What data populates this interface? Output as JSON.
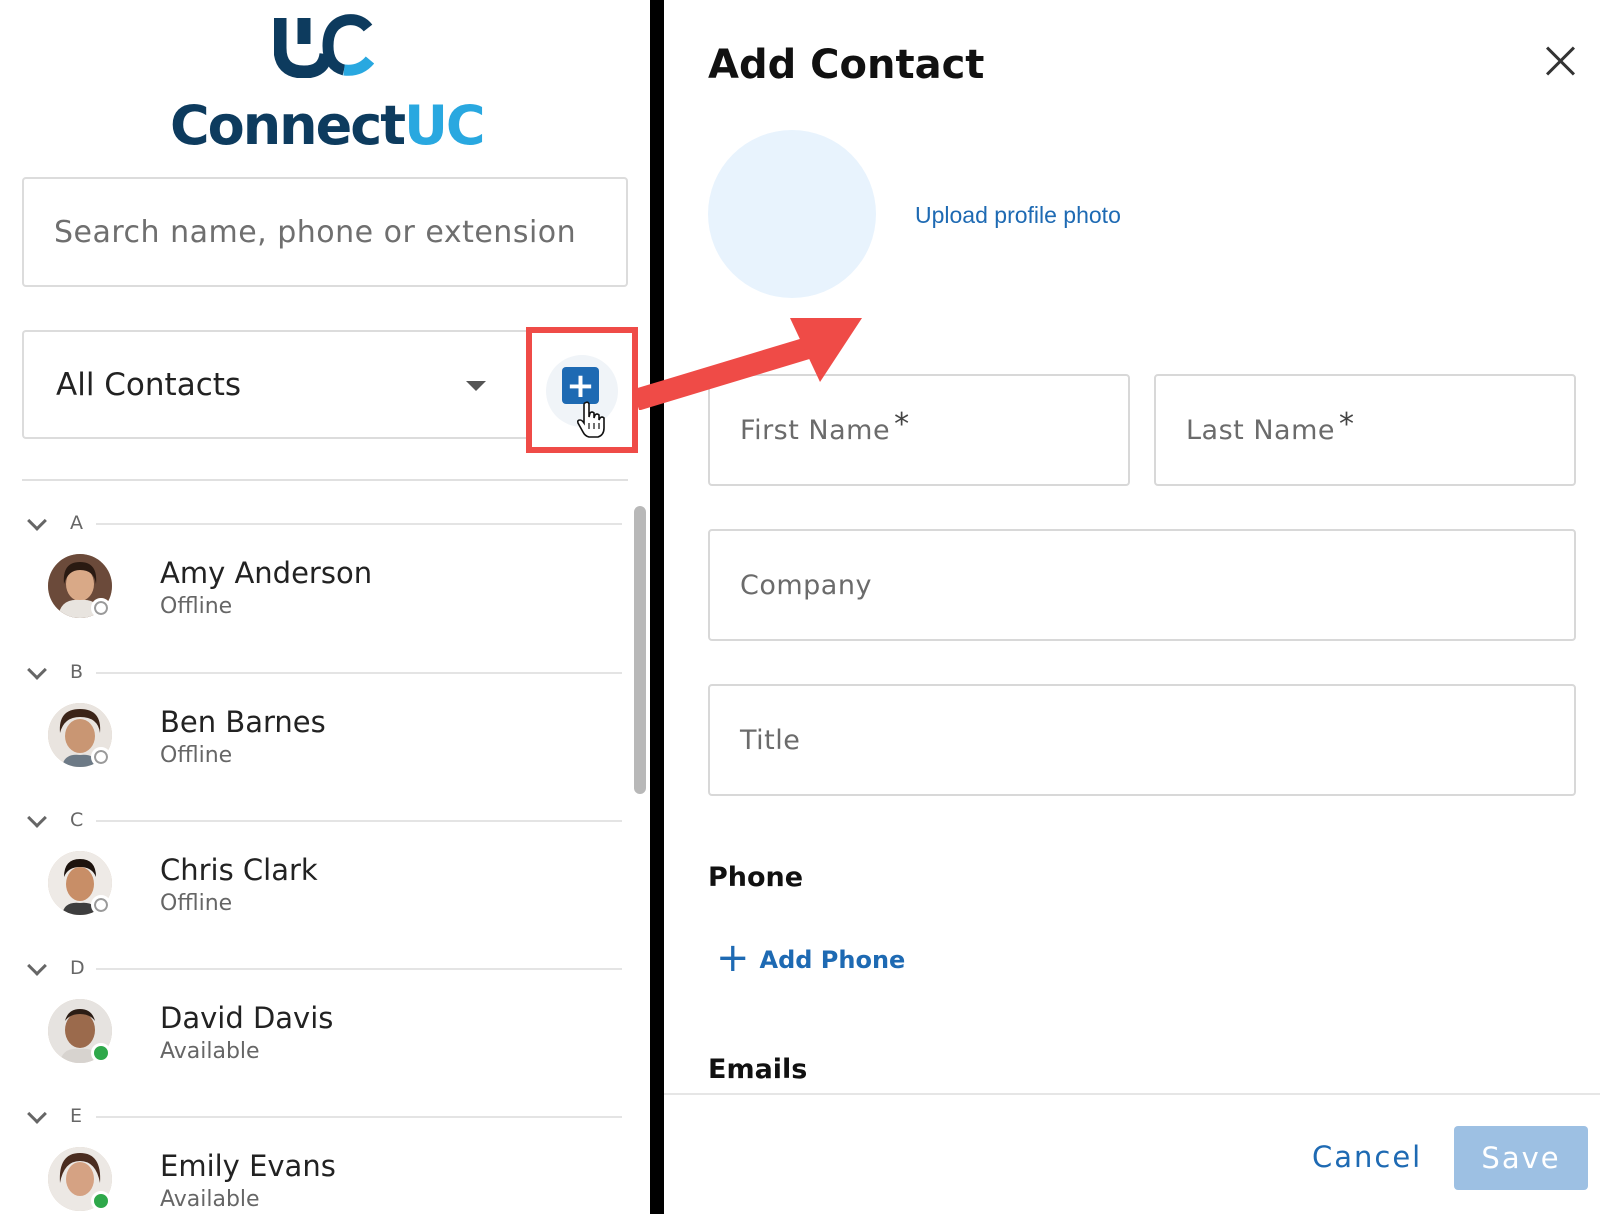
{
  "sidebar": {
    "logo": {
      "brand_text": "Connect",
      "brand_uc": "UC",
      "mark": "UC",
      "trademark": "™"
    },
    "search": {
      "placeholder": "Search name, phone or extension"
    },
    "filter": {
      "selected": "All Contacts"
    },
    "add_button_icon": "plus-square-icon",
    "groups": [
      {
        "letter": "A",
        "contact": {
          "name": "Amy Anderson",
          "status": "Offline"
        }
      },
      {
        "letter": "B",
        "contact": {
          "name": "Ben Barnes",
          "status": "Offline"
        }
      },
      {
        "letter": "C",
        "contact": {
          "name": "Chris Clark",
          "status": "Offline"
        }
      },
      {
        "letter": "D",
        "contact": {
          "name": "David Davis",
          "status": "Available"
        }
      },
      {
        "letter": "E",
        "contact": {
          "name": "Emily Evans",
          "status": "Available"
        }
      }
    ]
  },
  "panel": {
    "title": "Add Contact",
    "upload_label": "Upload profile photo",
    "fields": {
      "first_name": "First Name",
      "last_name": "Last Name",
      "required_mark": "*",
      "company": "Company",
      "title": "Title"
    },
    "phone_section": "Phone",
    "add_phone": "Add Phone",
    "emails_section": "Emails",
    "cancel_label": "Cancel",
    "save_label": "Save"
  },
  "colors": {
    "accent_blue": "#1e6ab3",
    "highlight_red": "#ef4b47",
    "status_available": "#2ea84a",
    "save_disabled": "#9dc0e3"
  }
}
